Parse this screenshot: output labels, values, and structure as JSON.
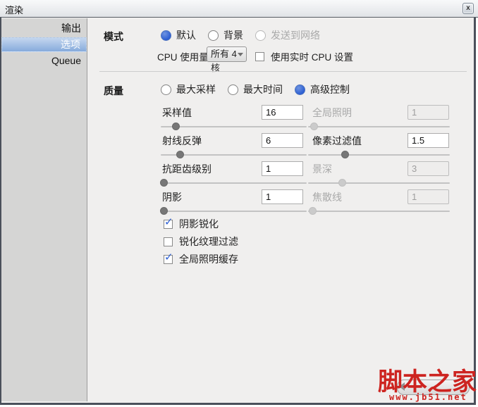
{
  "colors": {
    "accent": "#2d5fd3",
    "watermark": "#cd2420",
    "selection_top": "#c4d6ee",
    "selection_bottom": "#86abdc"
  },
  "window": {
    "title": "渲染",
    "close": "x"
  },
  "sidebar": {
    "items": [
      {
        "label": "输出",
        "selected": false
      },
      {
        "label": "选项",
        "selected": true
      },
      {
        "label": "Queue",
        "selected": false
      }
    ]
  },
  "mode": {
    "label": "模式",
    "options": [
      {
        "label": "默认",
        "selected": true,
        "disabled": false
      },
      {
        "label": "背景",
        "selected": false,
        "disabled": false
      },
      {
        "label": "发送到网络",
        "selected": false,
        "disabled": true
      }
    ],
    "cpu_label": "CPU 使用量",
    "cpu_value": "所有 4 核",
    "realtime_label": "使用实时 CPU 设置",
    "realtime_checked": false,
    "check_glyph": "✓"
  },
  "quality": {
    "label": "质量",
    "options": [
      {
        "label": "最大采样",
        "selected": false,
        "disabled": false
      },
      {
        "label": "最大时间",
        "selected": false,
        "disabled": false
      },
      {
        "label": "高级控制",
        "selected": true,
        "disabled": false
      }
    ],
    "sliders": [
      {
        "label": "采样值",
        "value": "16",
        "disabled": false,
        "pos": 10
      },
      {
        "label": "全局照明",
        "value": "1",
        "disabled": true,
        "pos": 4
      },
      {
        "label": "射线反弹",
        "value": "6",
        "disabled": false,
        "pos": 13
      },
      {
        "label": "像素过滤值",
        "value": "1.5",
        "disabled": false,
        "pos": 26
      },
      {
        "label": "抗距齿级别",
        "value": "1",
        "disabled": false,
        "pos": 2
      },
      {
        "label": "景深",
        "value": "3",
        "disabled": true,
        "pos": 24
      },
      {
        "label": "阴影",
        "value": "1",
        "disabled": false,
        "pos": 2
      },
      {
        "label": "焦散线",
        "value": "1",
        "disabled": true,
        "pos": 3
      }
    ],
    "checkboxes": [
      {
        "label": "阴影锐化",
        "checked": true
      },
      {
        "label": "锐化纹理过滤",
        "checked": false
      },
      {
        "label": "全局照明缓存",
        "checked": true
      }
    ]
  },
  "watermark": {
    "title": "脚本之家",
    "url": "www.jb51.net"
  }
}
